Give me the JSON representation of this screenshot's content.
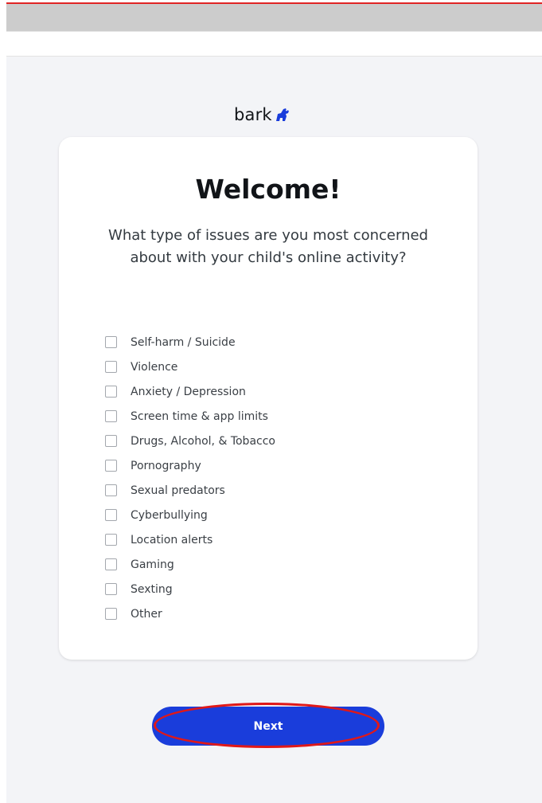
{
  "brand": {
    "logo_text": "bark",
    "logo_icon": "dog-icon",
    "accent_color": "#1a3ddb"
  },
  "card": {
    "title": "Welcome!",
    "question": "What type of issues are you most concerned about with your child's online activity?"
  },
  "options": [
    {
      "label": "Self-harm / Suicide",
      "checked": false
    },
    {
      "label": "Violence",
      "checked": false
    },
    {
      "label": "Anxiety / Depression",
      "checked": false
    },
    {
      "label": "Screen time & app limits",
      "checked": false
    },
    {
      "label": "Drugs, Alcohol, & Tobacco",
      "checked": false
    },
    {
      "label": "Pornography",
      "checked": false
    },
    {
      "label": "Sexual predators",
      "checked": false
    },
    {
      "label": "Cyberbullying",
      "checked": false
    },
    {
      "label": "Location alerts",
      "checked": false
    },
    {
      "label": "Gaming",
      "checked": false
    },
    {
      "label": "Sexting",
      "checked": false
    },
    {
      "label": "Other",
      "checked": false
    }
  ],
  "actions": {
    "next_label": "Next"
  },
  "annotation": {
    "highlight_color": "#e01818"
  }
}
